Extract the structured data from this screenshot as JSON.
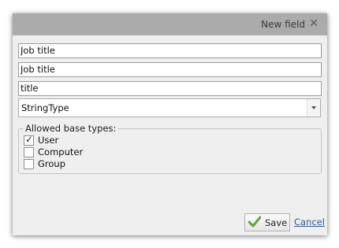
{
  "dialog": {
    "title": "New field",
    "close_glyph": "✕"
  },
  "fields": {
    "name": {
      "value": "Job title"
    },
    "display_name": {
      "value": "Job title"
    },
    "attribute": {
      "value": "title"
    }
  },
  "type_select": {
    "selected": "StringType"
  },
  "allowed_base_types": {
    "legend": "Allowed base types:",
    "options": [
      {
        "label": "User",
        "checked": true
      },
      {
        "label": "Computer",
        "checked": false
      },
      {
        "label": "Group",
        "checked": false
      }
    ]
  },
  "footer": {
    "save_label": "Save",
    "cancel_label": "Cancel"
  },
  "colors": {
    "title_bar": "#ababab",
    "dialog_background": "#efefef",
    "save_check": "#5aa83a",
    "cancel_link": "#2e5b9a"
  },
  "icons": {
    "close": "close-icon",
    "select_arrow": "chevron-down-icon",
    "save": "checkmark-icon"
  }
}
